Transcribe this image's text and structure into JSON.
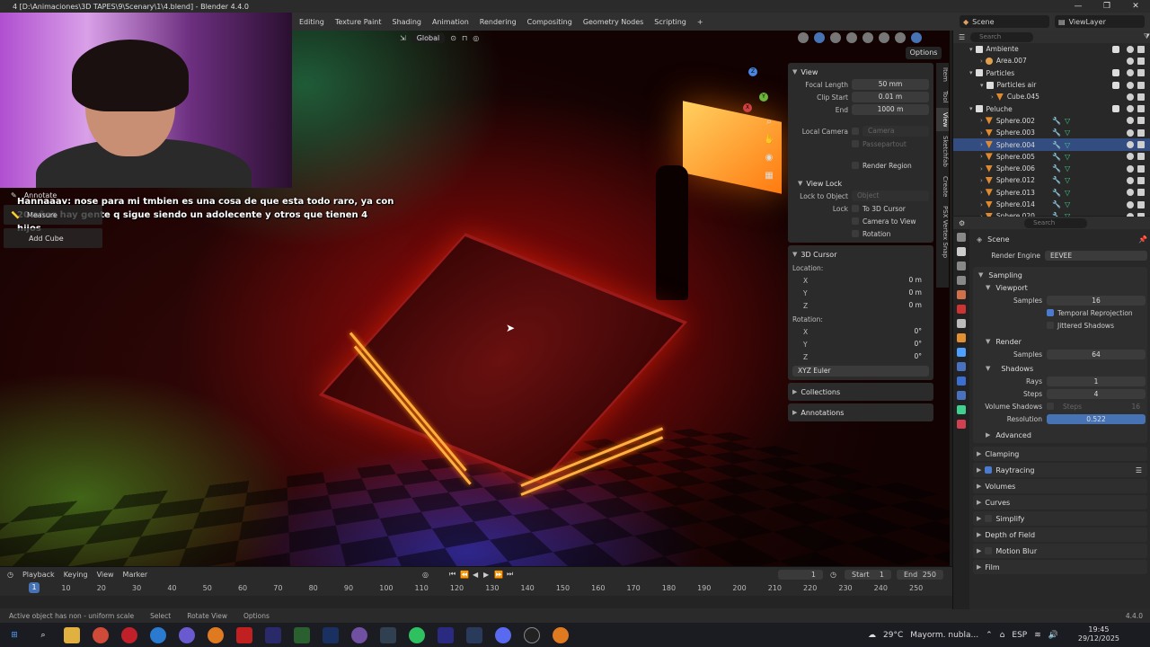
{
  "window": {
    "title": "4 [D:\\Animaciones\\3D TAPES\\9\\Scenary\\1\\4.blend] - Blender 4.4.0",
    "controls": [
      "—",
      "❐",
      "✕"
    ]
  },
  "workspaces": [
    "Editing",
    "Texture Paint",
    "Shading",
    "Animation",
    "Rendering",
    "Compositing",
    "Geometry Nodes",
    "Scripting",
    "+"
  ],
  "scene_selector": "Scene",
  "viewlayer_selector": "ViewLayer",
  "viewport": {
    "transform_orientation": "Global",
    "options_label": "Options",
    "gizmo_axes": [
      "Z",
      "Y",
      "X"
    ]
  },
  "chat": {
    "author": "Hannaaav",
    "message": ": nose para mi tmbien es una cosa de que esta todo raro, ya con 20 años hay gente q sigue siendo un adolecente y otros que tienen 4 hijos"
  },
  "tools": {
    "annotate": "Annotate",
    "measure": "Measure",
    "add_cube": "Add Cube"
  },
  "npanel": {
    "view": {
      "header": "View",
      "focal_length_label": "Focal Length",
      "focal_length": "50 mm",
      "clip_start_label": "Clip Start",
      "clip_start": "0.01 m",
      "end_label": "End",
      "end": "1000 m",
      "local_camera_label": "Local Camera",
      "camera_placeholder": "Camera",
      "passepartout": "Passepartout",
      "render_region": "Render Region"
    },
    "view_lock": {
      "header": "View Lock",
      "lock_to_object_label": "Lock to Object",
      "object_placeholder": "Object",
      "lock_label": "Lock",
      "to_3d_cursor": "To 3D Cursor",
      "camera_to_view": "Camera to View",
      "rotation": "Rotation"
    },
    "cursor": {
      "header": "3D Cursor",
      "location_label": "Location:",
      "loc_x": "0 m",
      "loc_y": "0 m",
      "loc_z": "0 m",
      "rotation_label": "Rotation:",
      "rot_x": "0°",
      "rot_y": "0°",
      "rot_z": "0°",
      "rotation_mode": "XYZ Euler"
    },
    "collections": "Collections",
    "annotations": "Annotations",
    "tabs": [
      "Item",
      "Tool",
      "View",
      "Sketchfab",
      "Create",
      "PSX Vertex Snap"
    ]
  },
  "outliner": {
    "search_placeholder": "Search",
    "rows": [
      {
        "name": "Ambiente",
        "indent": 1,
        "kind": "collection"
      },
      {
        "name": "Area.007",
        "indent": 2,
        "kind": "light"
      },
      {
        "name": "Particles",
        "indent": 1,
        "kind": "collection"
      },
      {
        "name": "Particles air",
        "indent": 2,
        "kind": "collection"
      },
      {
        "name": "Cube.045",
        "indent": 3,
        "kind": "mesh"
      },
      {
        "name": "Peluche",
        "indent": 1,
        "kind": "collection"
      },
      {
        "name": "Sphere.002",
        "indent": 2,
        "kind": "mesh"
      },
      {
        "name": "Sphere.003",
        "indent": 2,
        "kind": "mesh"
      },
      {
        "name": "Sphere.004",
        "indent": 2,
        "kind": "mesh",
        "selected": true
      },
      {
        "name": "Sphere.005",
        "indent": 2,
        "kind": "mesh"
      },
      {
        "name": "Sphere.006",
        "indent": 2,
        "kind": "mesh"
      },
      {
        "name": "Sphere.012",
        "indent": 2,
        "kind": "mesh"
      },
      {
        "name": "Sphere.013",
        "indent": 2,
        "kind": "mesh"
      },
      {
        "name": "Sphere.014",
        "indent": 2,
        "kind": "mesh"
      },
      {
        "name": "Sphere.020",
        "indent": 2,
        "kind": "mesh"
      }
    ]
  },
  "properties": {
    "search_placeholder": "Search",
    "context": "Scene",
    "render_engine_label": "Render Engine",
    "render_engine": "EEVEE",
    "sampling": "Sampling",
    "viewport": "Viewport",
    "viewport_samples_label": "Samples",
    "viewport_samples": "16",
    "temporal_reprojection": "Temporal Reprojection",
    "jittered_shadows": "Jittered Shadows",
    "render": "Render",
    "render_samples_label": "Samples",
    "render_samples": "64",
    "shadows": "Shadows",
    "rays_label": "Rays",
    "rays": "1",
    "steps_label": "Steps",
    "steps": "4",
    "volume_shadows_label": "Volume Shadows",
    "volume_steps_label": "Steps",
    "volume_steps": "16",
    "resolution_label": "Resolution",
    "resolution": "0.522",
    "advanced": "Advanced",
    "clamping": "Clamping",
    "raytracing": "Raytracing",
    "volumes": "Volumes",
    "curves": "Curves",
    "simplify": "Simplify",
    "depth_of_field": "Depth of Field",
    "motion_blur": "Motion Blur",
    "film": "Film"
  },
  "timeline": {
    "menus": [
      "Playback",
      "Keying",
      "View",
      "Marker"
    ],
    "current_frame": "1",
    "start_label": "Start",
    "start": "1",
    "end_label": "End",
    "end": "250",
    "ticks": [
      "1",
      "10",
      "20",
      "30",
      "40",
      "50",
      "60",
      "70",
      "80",
      "90",
      "100",
      "110",
      "120",
      "130",
      "140",
      "150",
      "160",
      "170",
      "180",
      "190",
      "200",
      "210",
      "220",
      "230",
      "240",
      "250"
    ]
  },
  "statusbar": {
    "message": "Active object has non - uniform scale",
    "select": "Select",
    "rotate_view": "Rotate View",
    "options": "Options",
    "version": "4.4.0"
  },
  "taskbar": {
    "weather_temp": "29°C",
    "weather_text": "Mayorm. nubla...",
    "language": "ESP",
    "time": "19:45",
    "date": "29/12/2025"
  },
  "colors": {
    "accent": "#4772b3",
    "selected_row": "#334d80",
    "mesh_icon": "#3fcf8e",
    "modifier_icon": "#4da0ff"
  }
}
